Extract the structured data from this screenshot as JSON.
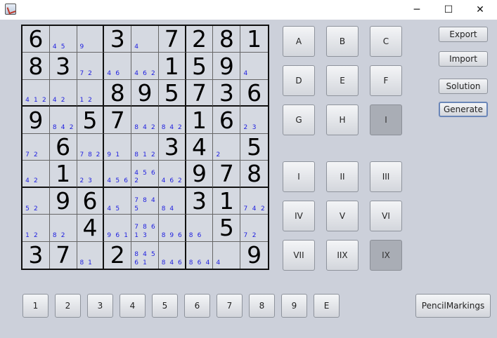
{
  "titlebar": {
    "minimize_glyph": "─",
    "maximize_glyph": "☐",
    "close_glyph": "✕"
  },
  "grid": {
    "cells": [
      [
        {
          "value": "6"
        },
        {
          "marks": [
            "4",
            "5"
          ]
        },
        {
          "marks": [
            "9"
          ]
        },
        {
          "value": "3"
        },
        {
          "marks": [
            "4"
          ]
        },
        {
          "value": "7"
        },
        {
          "value": "2"
        },
        {
          "value": "8"
        },
        {
          "value": "1"
        }
      ],
      [
        {
          "value": "8"
        },
        {
          "value": "3"
        },
        {
          "marks": [
            "7",
            "2"
          ]
        },
        {
          "marks": [
            "4",
            "6"
          ]
        },
        {
          "marks": [
            "4",
            "6",
            "2"
          ]
        },
        {
          "value": "1"
        },
        {
          "value": "5"
        },
        {
          "value": "9"
        },
        {
          "marks": [
            "4"
          ]
        }
      ],
      [
        {
          "marks": [
            "4",
            "1",
            "2"
          ]
        },
        {
          "marks": [
            "4",
            "2"
          ]
        },
        {
          "marks": [
            "1",
            "2"
          ]
        },
        {
          "value": "8"
        },
        {
          "value": "9"
        },
        {
          "value": "5"
        },
        {
          "value": "7"
        },
        {
          "value": "3"
        },
        {
          "value": "6"
        }
      ],
      [
        {
          "value": "9"
        },
        {
          "marks": [
            "8",
            "4",
            "2"
          ]
        },
        {
          "value": "5"
        },
        {
          "value": "7"
        },
        {
          "marks": [
            "8",
            "4",
            "2"
          ]
        },
        {
          "marks": [
            "8",
            "4",
            "2"
          ]
        },
        {
          "value": "1"
        },
        {
          "value": "6"
        },
        {
          "marks": [
            "2",
            "3"
          ]
        }
      ],
      [
        {
          "marks": [
            "7",
            "2"
          ]
        },
        {
          "value": "6"
        },
        {
          "marks": [
            "7",
            "8",
            "2"
          ]
        },
        {
          "marks": [
            "9",
            "1"
          ]
        },
        {
          "marks": [
            "8",
            "1",
            "2"
          ]
        },
        {
          "value": "3"
        },
        {
          "value": "4"
        },
        {
          "marks": [
            "2"
          ]
        },
        {
          "value": "5"
        }
      ],
      [
        {
          "marks": [
            "4",
            "2"
          ]
        },
        {
          "value": "1"
        },
        {
          "marks": [
            "2",
            "3"
          ]
        },
        {
          "marks": [
            "4",
            "5",
            "6"
          ]
        },
        {
          "marks": [
            "4",
            "5",
            "6",
            "2"
          ]
        },
        {
          "marks": [
            "4",
            "6",
            "2"
          ]
        },
        {
          "value": "9"
        },
        {
          "value": "7"
        },
        {
          "value": "8"
        }
      ],
      [
        {
          "marks": [
            "5",
            "2"
          ]
        },
        {
          "value": "9"
        },
        {
          "value": "6"
        },
        {
          "marks": [
            "4",
            "5"
          ]
        },
        {
          "marks": [
            "7",
            "8",
            "4",
            "5"
          ]
        },
        {
          "marks": [
            "8",
            "4"
          ]
        },
        {
          "value": "3"
        },
        {
          "value": "1"
        },
        {
          "marks": [
            "7",
            "4",
            "2"
          ]
        }
      ],
      [
        {
          "marks": [
            "1",
            "2"
          ]
        },
        {
          "marks": [
            "8",
            "2"
          ]
        },
        {
          "value": "4"
        },
        {
          "marks": [
            "9",
            "6",
            "1"
          ]
        },
        {
          "marks": [
            "7",
            "8",
            "6",
            "1",
            "3"
          ]
        },
        {
          "marks": [
            "8",
            "9",
            "6"
          ]
        },
        {
          "marks": [
            "8",
            "6"
          ]
        },
        {
          "value": "5"
        },
        {
          "marks": [
            "7",
            "2"
          ]
        }
      ],
      [
        {
          "value": "3"
        },
        {
          "value": "7"
        },
        {
          "marks": [
            "8",
            "1"
          ]
        },
        {
          "value": "2"
        },
        {
          "marks": [
            "8",
            "4",
            "5",
            "6",
            "1"
          ]
        },
        {
          "marks": [
            "8",
            "4",
            "6"
          ]
        },
        {
          "marks": [
            "8",
            "6",
            "4"
          ]
        },
        {
          "marks": [
            "4"
          ]
        },
        {
          "value": "9"
        }
      ]
    ]
  },
  "block_buttons": [
    "A",
    "B",
    "C",
    "D",
    "E",
    "F",
    "G",
    "H",
    "I"
  ],
  "roman_buttons": [
    "I",
    "II",
    "III",
    "IV",
    "V",
    "VI",
    "VII",
    "IIX",
    "IX"
  ],
  "number_buttons": [
    "1",
    "2",
    "3",
    "4",
    "5",
    "6",
    "7",
    "8",
    "9",
    "E"
  ],
  "side": {
    "export_label": "Export",
    "import_label": "Import",
    "solution_label": "Solution",
    "generate_label": "Generate"
  },
  "pencil_label": "PencilMarkings"
}
